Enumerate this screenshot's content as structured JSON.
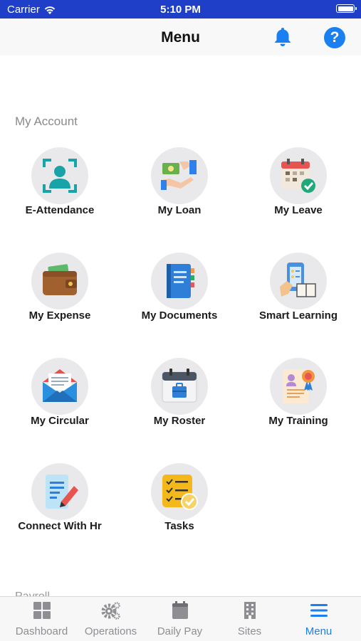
{
  "status_bar": {
    "carrier": "Carrier",
    "time": "5:10 PM"
  },
  "header": {
    "title": "Menu",
    "help_glyph": "?"
  },
  "section": {
    "title": "My Account",
    "next_title": "Payroll"
  },
  "menu_items": [
    {
      "label": "E-Attendance",
      "icon": "face-scan-icon"
    },
    {
      "label": "My Loan",
      "icon": "loan-icon"
    },
    {
      "label": "My Leave",
      "icon": "leave-calendar-icon"
    },
    {
      "label": "My Expense",
      "icon": "wallet-icon"
    },
    {
      "label": "My Documents",
      "icon": "documents-icon"
    },
    {
      "label": "Smart Learning",
      "icon": "learning-icon"
    },
    {
      "label": "My Circular",
      "icon": "envelope-icon"
    },
    {
      "label": "My Roster",
      "icon": "roster-calendar-icon"
    },
    {
      "label": "My Training",
      "icon": "certificate-icon"
    },
    {
      "label": "Connect With Hr",
      "icon": "hr-note-icon"
    },
    {
      "label": "Tasks",
      "icon": "tasks-icon"
    }
  ],
  "tabs": [
    {
      "label": "Dashboard",
      "icon": "dashboard-icon",
      "active": false
    },
    {
      "label": "Operations",
      "icon": "gears-icon",
      "active": false
    },
    {
      "label": "Daily Pay",
      "icon": "calendar-icon",
      "active": false
    },
    {
      "label": "Sites",
      "icon": "building-icon",
      "active": false
    },
    {
      "label": "Menu",
      "icon": "hamburger-icon",
      "active": true
    }
  ],
  "colors": {
    "status_bar": "#1f3fc8",
    "accent": "#1a7ff0",
    "icon_circle": "#e9e9ec",
    "tab_inactive": "#8e8e93"
  }
}
